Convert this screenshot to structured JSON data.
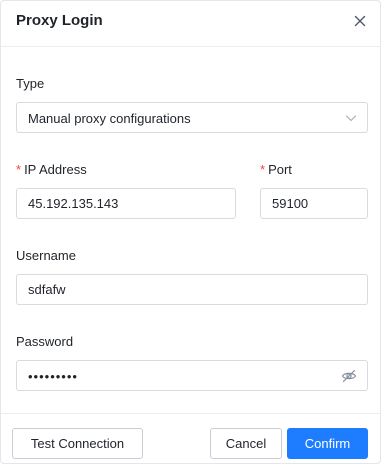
{
  "dialog": {
    "title": "Proxy Login",
    "close_icon": "close-icon"
  },
  "form": {
    "type": {
      "label": "Type",
      "value": "Manual proxy configurations",
      "icon": "chevron-down-icon"
    },
    "ip_address": {
      "required_mark": "*",
      "label": "IP Address",
      "value": "45.192.135.143"
    },
    "port": {
      "required_mark": "*",
      "label": "Port",
      "value": "59100"
    },
    "username": {
      "label": "Username",
      "value": "sdfafw"
    },
    "password": {
      "label": "Password",
      "value": "•••••••••",
      "icon": "eye-off-icon"
    }
  },
  "footer": {
    "test_label": "Test Connection",
    "cancel_label": "Cancel",
    "confirm_label": "Confirm"
  },
  "colors": {
    "primary": "#1e7dff",
    "required": "#f53f3f",
    "border": "#d9dbe0"
  }
}
